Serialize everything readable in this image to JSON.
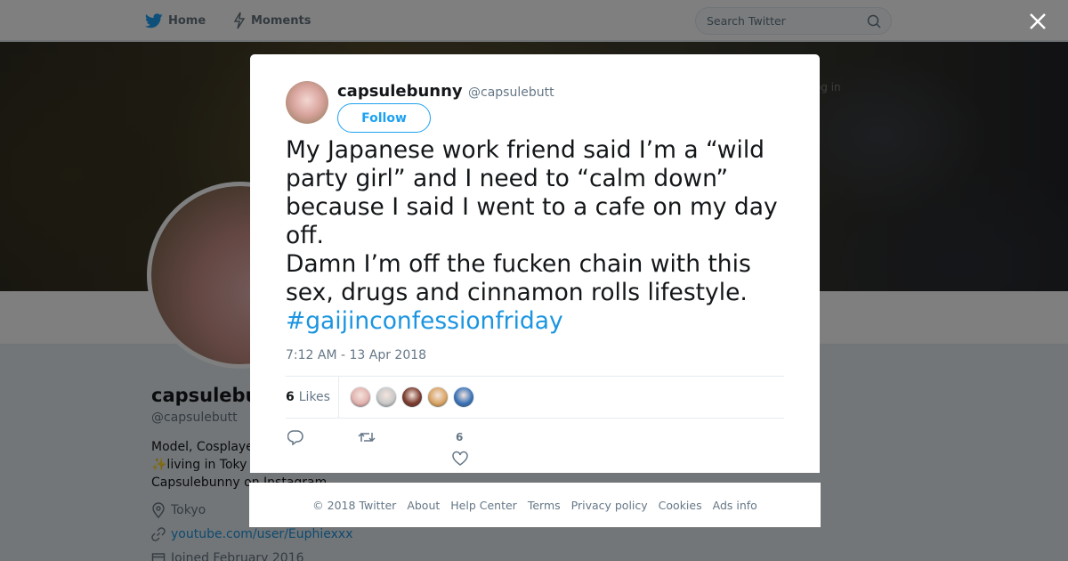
{
  "nav": {
    "home_label": "Home",
    "moments_label": "Moments",
    "search_placeholder": "Search Twitter",
    "brand_color": "#1da1f2"
  },
  "banner": {
    "overlay_text": "Have an account? Log in"
  },
  "profile": {
    "name": "capsulebu",
    "handle": "@capsulebutt",
    "bio_line1": "Model, Cosplaye",
    "bio_line2": "✨living in Toky",
    "bio_line3": "Capsulebunny on Instagram",
    "location": "Tokyo",
    "link": "youtube.com/user/Euphiexxx",
    "joined": "Joined February 2016"
  },
  "tweet": {
    "author_name": "capsulebunny",
    "author_handle": "@capsulebutt",
    "follow_label": "Follow",
    "text_line1": "My Japanese work friend said I’m a “wild party girl” and I need to “calm down” because I said I went to a cafe on my day off.",
    "text_line2": "Damn I’m off the fucken chain with this sex, drugs and cinnamon rolls lifestyle.",
    "hashtag": "#gaijinconfessionfriday",
    "timestamp": "7:12 AM - 13 Apr 2018",
    "likes_count": "6",
    "likes_label": "Likes",
    "like_action_count": "6",
    "liker_avatar_colors": [
      "#e2b3b0",
      "#c9c9c9",
      "#7a3b2e",
      "#d8a464",
      "#3a73b8"
    ]
  },
  "footer": {
    "links": [
      "© 2018 Twitter",
      "About",
      "Help Center",
      "Terms",
      "Privacy policy",
      "Cookies",
      "Ads info"
    ]
  }
}
